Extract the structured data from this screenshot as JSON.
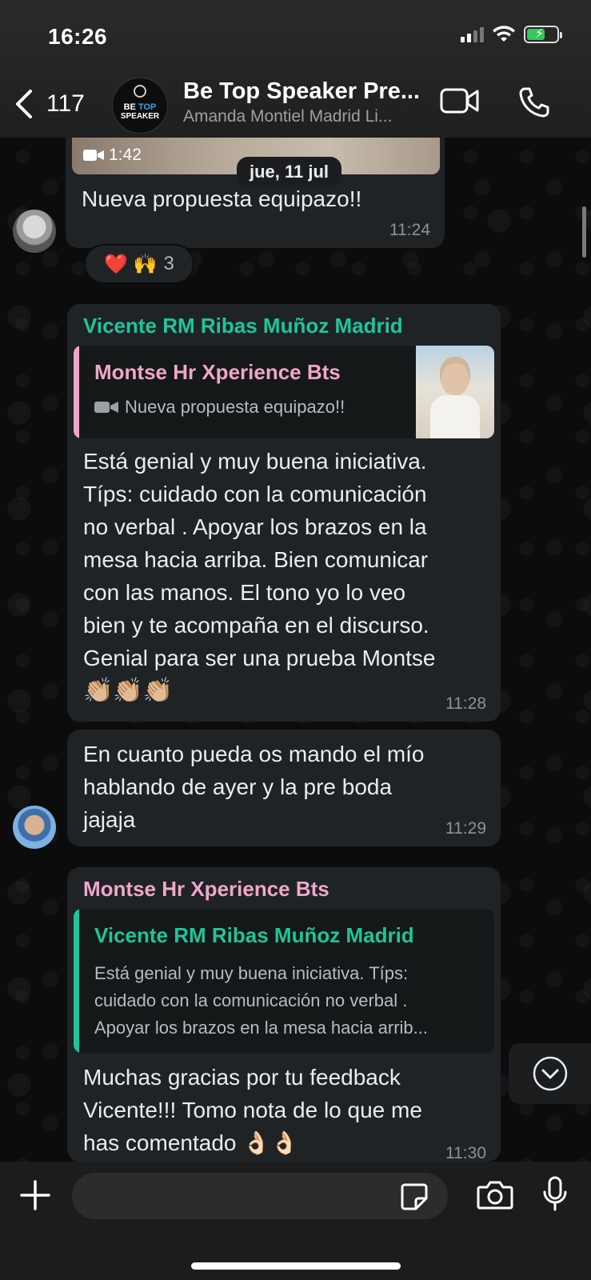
{
  "status_bar": {
    "time": "16:26"
  },
  "header": {
    "back_count": "117",
    "avatar_line1_a": "BE",
    "avatar_line1_b": "TOP",
    "avatar_line2": "SPEAKER",
    "title": "Be Top Speaker Pre...",
    "subtitle": "Amanda Montiel Madrid Li..."
  },
  "messages": [
    {
      "video_duration": "1:42",
      "text": "Nueva propuesta equipazo!!",
      "time": "11:24",
      "reactions": {
        "emojis": "❤️ 🙌",
        "count": "3"
      }
    },
    {
      "sender": "Vicente RM Ribas Muñoz Madrid",
      "sender_color": "#1fc59a",
      "quote": {
        "sender": "Montse Hr Xperience  Bts",
        "sender_color": "#f0a6c9",
        "text": "Nueva propuesta equipazo!!"
      },
      "lines": [
        "Está genial y muy buena iniciativa.",
        "Típs: cuidado con la comunicación",
        "no verbal . Apoyar los brazos en la",
        "mesa hacia arriba. Bien comunicar",
        "con las manos. El tono yo lo veo",
        "bien y te acompaña en el discurso.",
        "Genial para ser una prueba Montse",
        "👏🏼👏🏼👏🏼"
      ],
      "time": "11:28"
    },
    {
      "lines": [
        "En cuanto pueda os mando el mío",
        "hablando de ayer y la pre boda",
        "jajaja"
      ],
      "time": "11:29"
    },
    {
      "sender": "Montse Hr Xperience  Bts",
      "sender_color": "#f0a6c9",
      "quote": {
        "sender": "Vicente RM Ribas Muñoz Madrid",
        "sender_color": "#1fc59a",
        "lines": [
          "Está genial y muy buena iniciativa. Típs:",
          "cuidado con la comunicación no verbal .",
          "Apoyar los brazos en la mesa hacia arrib..."
        ]
      },
      "lines": [
        "Muchas gracias por tu feedback",
        "Vicente!!! Tomo nota de lo que me",
        "has comentado 👌🏻👌🏻"
      ],
      "time": "11:30"
    }
  ],
  "date_divider": "jue, 11 jul",
  "icons": {
    "back": "chevron-left-icon",
    "video": "video-call-icon",
    "call": "phone-icon",
    "plus": "plus-icon",
    "sticker": "sticker-icon",
    "camera": "camera-icon",
    "mic": "mic-icon",
    "scroll": "chevron-down-icon"
  }
}
